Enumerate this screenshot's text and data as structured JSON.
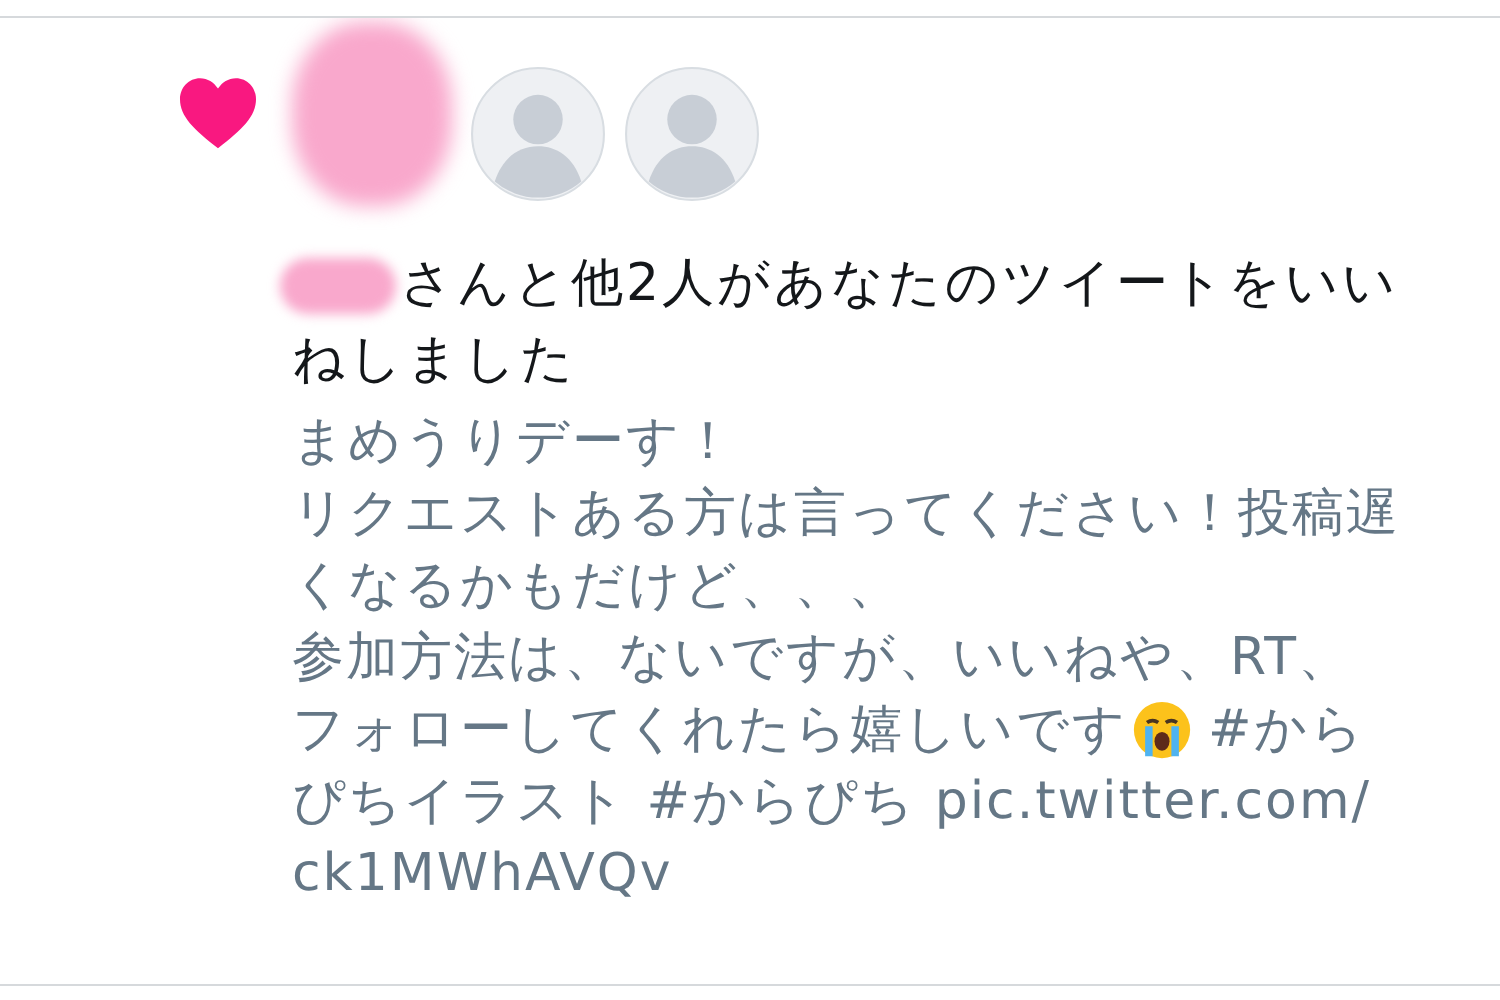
{
  "notification": {
    "kind": "like",
    "avatars": [
      {
        "kind": "redacted"
      },
      {
        "kind": "photo"
      },
      {
        "kind": "photo"
      }
    ],
    "headline": {
      "name_redacted": true,
      "text": "さんと他2人があなたのツイートをいいねしました"
    },
    "tweet_lines": [
      {
        "kind": "text",
        "text": "まめうりデーす！"
      },
      {
        "kind": "text",
        "text": "リクエストある方は言ってください！投稿遅"
      },
      {
        "kind": "text",
        "text": "くなるかもだけど、、、"
      },
      {
        "kind": "text",
        "text": "参加方法は、ないですが、いいねや、RT、"
      },
      {
        "kind": "emoji",
        "before": "フォローしてくれたら嬉しいです",
        "after": "#から"
      },
      {
        "kind": "text",
        "text": "ぴちイラスト  #からぴち pic.twitter.com/"
      },
      {
        "kind": "text",
        "text": "ck1MWhAVQv"
      }
    ]
  }
}
